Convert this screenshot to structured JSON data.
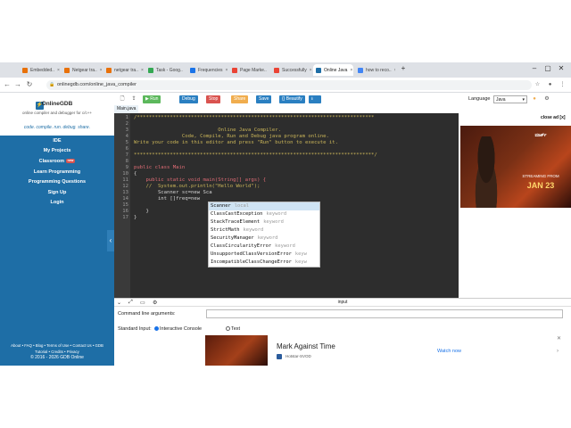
{
  "browser": {
    "tabs": [
      {
        "label": "Embedded..",
        "color": "#e8710a"
      },
      {
        "label": "Netgear tra..",
        "color": "#e8710a"
      },
      {
        "label": "netgear tra..",
        "color": "#e8710a"
      },
      {
        "label": "Task - Goog..",
        "color": "#34a853"
      },
      {
        "label": "Frequencies",
        "color": "#1a73e8"
      },
      {
        "label": "Page Marke..",
        "color": "#ea4335"
      },
      {
        "label": "Successfully",
        "color": "#ea4335"
      },
      {
        "label": "Online Java",
        "color": "#1e6ea6",
        "active": true
      },
      {
        "label": "how to reco..",
        "color": "#4285f4"
      }
    ],
    "new_tab": "+",
    "url": "onlinegdb.com/online_java_compiler"
  },
  "sidebar": {
    "brand_title": "OnlineGDB",
    "brand_sub": "online compiler and debugger for c/c++",
    "tagline": "code. compile. run. debug. share.",
    "items": [
      "IDE",
      "My Projects",
      "Classroom",
      "Learn Programming",
      "Programming Questions",
      "Sign Up",
      "Login"
    ],
    "new_badge": "new",
    "footer_line1": "About • FAQ • Blog • Terms of Use • Contact Us • GDB",
    "footer_line2": "Tutorial • Credits • Privacy",
    "footer_line3": "© 2016 - 2026 GDB Online"
  },
  "toolbar": {
    "run": "▶ Run",
    "debug": "Debug",
    "stop": "Stop",
    "share": "Share",
    "save": "Save",
    "beautify": "{} Beautify",
    "language_label": "Language",
    "language_value": "Java",
    "run_color": "#5cb85c",
    "debug_color": "#2a7fc1",
    "stop_color": "#d9534f",
    "share_color": "#f0ad4e",
    "save_color": "#2a7fc1"
  },
  "file_tab": "Main.java",
  "editor": {
    "line_numbers": [
      "1",
      "2",
      "3",
      "4",
      "5",
      "6",
      "7",
      "8",
      "9",
      "10",
      "11",
      "12",
      "13",
      "14",
      "15",
      "16",
      "17"
    ],
    "lines": [
      "/*******************************************************************************",
      "",
      "                            Online Java Compiler.",
      "                Code, Compile, Run and Debug java program online.",
      "Write your code in this editor and press \"Run\" button to execute it.",
      "",
      "********************************************************************************/",
      "",
      "public class Main",
      "{",
      "    public static void main(String[] args) {",
      "    //  System.out.println(\"Hello World\");",
      "        Scanner sc=new Sca",
      "        int []freq=new",
      "",
      "    }",
      "}"
    ]
  },
  "autocomplete": [
    {
      "name": "Scanner",
      "meta": "local"
    },
    {
      "name": "ClassCastException",
      "meta": "keyword"
    },
    {
      "name": "StackTraceElement",
      "meta": "keyword"
    },
    {
      "name": "StrictMath",
      "meta": "keyword"
    },
    {
      "name": "SecurityManager",
      "meta": "keyword"
    },
    {
      "name": "ClassCircularityError",
      "meta": "keyword"
    },
    {
      "name": "UnsupportedClassVersionError",
      "meta": "keyw"
    },
    {
      "name": "IncompatibleClassChangeError",
      "meta": "keyw"
    }
  ],
  "ad": {
    "close": "close ad [x]",
    "streaming": "STREAMING FROM",
    "date": "JAN 23"
  },
  "io": {
    "title": "input",
    "cla_label": "Command line arguments:",
    "stdin_label": "Standard Input:",
    "opt_console": "Interactive Console",
    "opt_text": "Text"
  },
  "bottom_ad": {
    "title": "Mark Against Time",
    "source": "Hotstar-SVOD",
    "button": "Watch now",
    "close": "✕"
  }
}
